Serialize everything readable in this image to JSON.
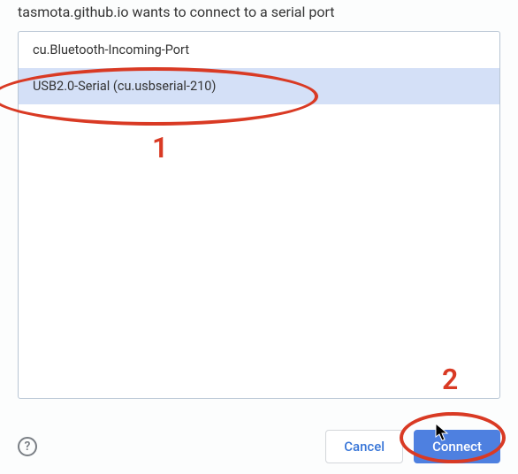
{
  "dialog": {
    "title": "tasmota.github.io wants to connect to a serial port"
  },
  "ports": [
    {
      "label": "cu.Bluetooth-Incoming-Port",
      "selected": false
    },
    {
      "label": "USB2.0-Serial (cu.usbserial-210)",
      "selected": true
    }
  ],
  "buttons": {
    "cancel": "Cancel",
    "connect": "Connect",
    "help_glyph": "?"
  },
  "annotations": {
    "marker1": "1",
    "marker2": "2"
  }
}
